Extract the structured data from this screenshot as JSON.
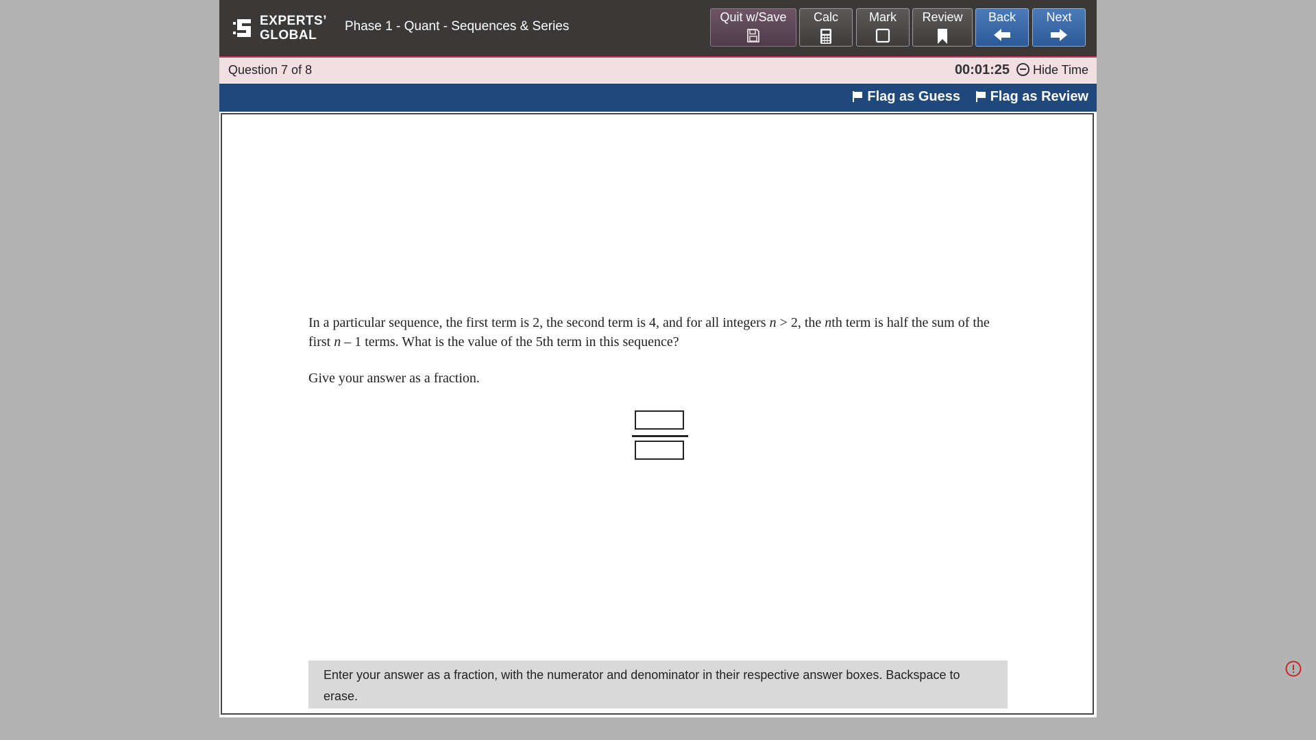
{
  "header": {
    "logo_line1": "EXPERTS’",
    "logo_line2": "GLOBAL",
    "test_title": "Phase 1 - Quant - Sequences & Series",
    "buttons": {
      "quit": "Quit w/Save",
      "calc": "Calc",
      "mark": "Mark",
      "review": "Review",
      "back": "Back",
      "next": "Next"
    }
  },
  "status": {
    "question_count": "Question 7 of 8",
    "timer": "00:01:25",
    "hide_time": "Hide Time"
  },
  "flags": {
    "guess": "Flag as Guess",
    "review": "Flag as Review"
  },
  "question": {
    "part1": "In a particular sequence, the first term is 2, the second term is 4, and for all integers ",
    "var1": "n",
    "part2": " > 2, the ",
    "var2": "n",
    "part3": "th term is half the sum of the first ",
    "var3": "n",
    "part4": " – 1 terms. What is the value of the 5th term in this sequence?",
    "instruction": "Give your answer as a fraction."
  },
  "answer": {
    "numerator": "",
    "denominator": ""
  },
  "help_text": "Enter your answer as a fraction, with the numerator and denominator in their respective answer boxes. Backspace to erase.",
  "colors": {
    "topbar": "#3b3838",
    "accent": "#c0315a",
    "status_bg": "#f2dfe4",
    "flagbar": "#1f497d",
    "nav_button": "#2c5a99",
    "quit_button": "#5e4957"
  },
  "icons": {
    "quit": "floppy-disk-icon",
    "calc": "calculator-icon",
    "mark": "checkbox-icon",
    "review": "bookmark-icon",
    "back": "arrow-left-icon",
    "next": "arrow-right-icon",
    "flag": "flag-icon",
    "alert": "alert-circle-icon"
  }
}
